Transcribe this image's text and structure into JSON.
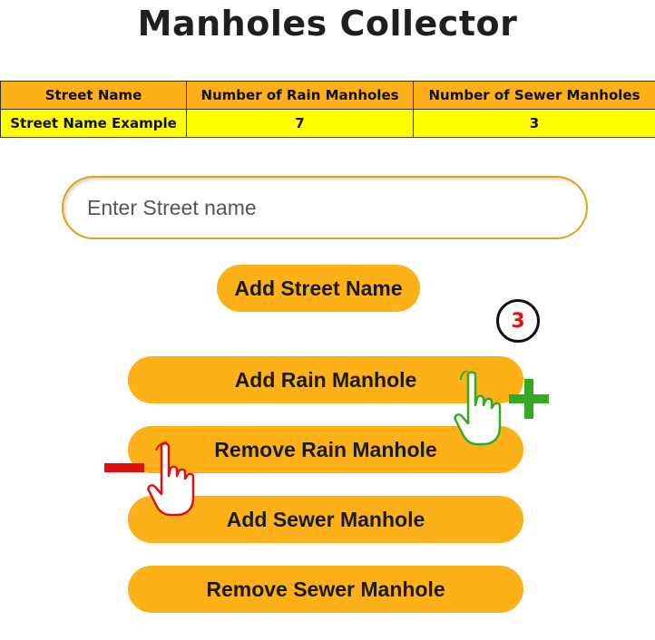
{
  "page": {
    "title": "Manholes Collector"
  },
  "table": {
    "headers": [
      "Street Name",
      "Number of Rain Manholes",
      "Number of Sewer Manholes"
    ],
    "rows": [
      [
        "Street Name Example",
        "7",
        "3"
      ]
    ]
  },
  "form": {
    "street_input_placeholder": "Enter Street name",
    "street_input_value": "",
    "add_street_label": "Add Street Name"
  },
  "actions": {
    "add_rain_label": "Add Rain Manhole",
    "remove_rain_label": "Remove Rain Manhole",
    "add_sewer_label": "Add Sewer Manhole",
    "remove_sewer_label": "Remove Sewer Manhole"
  },
  "annotations": {
    "step_number": "3",
    "step_color": "#e01010",
    "plus_color": "#33aa22",
    "minus_color": "#e01010",
    "hand_add_icon": "pointing-hand-icon",
    "hand_remove_icon": "pointing-hand-icon"
  },
  "colors": {
    "button_bg": "#fbb117",
    "header_bg": "#fbb117",
    "cell_bg": "#ffff00"
  }
}
